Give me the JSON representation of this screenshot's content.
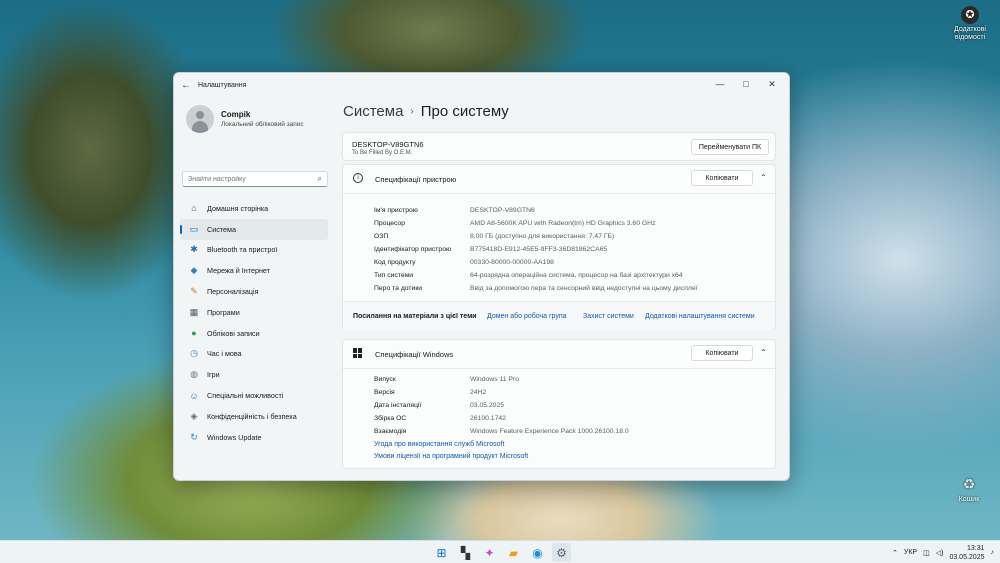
{
  "desktop": {
    "icons": [
      {
        "label": "Додаткові відомості",
        "icon": "info-circle-icon"
      },
      {
        "label": "Кошик",
        "icon": "recycle-bin-icon"
      }
    ]
  },
  "window": {
    "title": "Налаштування",
    "controls": {
      "minimize": "—",
      "maximize": "□",
      "close": "✕"
    }
  },
  "profile": {
    "name": "Compik",
    "subtitle": "Локальний обліковий запис"
  },
  "search": {
    "placeholder": "Знайти настройку"
  },
  "nav": [
    {
      "label": "Домашня сторінка",
      "icon": "home-icon",
      "glyph": "⌂",
      "color": "#555"
    },
    {
      "label": "Система",
      "icon": "monitor-icon",
      "glyph": "▭",
      "color": "#0067c0",
      "active": true
    },
    {
      "label": "Bluetooth та пристрої",
      "icon": "bluetooth-icon",
      "glyph": "✱",
      "color": "#1f6fc0"
    },
    {
      "label": "Мережа й Інтернет",
      "icon": "network-icon",
      "glyph": "◆",
      "color": "#3b7ac7"
    },
    {
      "label": "Персоналізація",
      "icon": "paintbrush-icon",
      "glyph": "✎",
      "color": "#c87a2a"
    },
    {
      "label": "Програми",
      "icon": "apps-icon",
      "glyph": "▦",
      "color": "#4d5a66"
    },
    {
      "label": "Облікові записи",
      "icon": "user-icon",
      "glyph": "●",
      "color": "#2f9b5a"
    },
    {
      "label": "Час і мова",
      "icon": "globe-clock-icon",
      "glyph": "◷",
      "color": "#2c7fd1"
    },
    {
      "label": "Ігри",
      "icon": "gamepad-icon",
      "glyph": "◍",
      "color": "#6b737a"
    },
    {
      "label": "Спеціальні можливості",
      "icon": "accessibility-icon",
      "glyph": "☺",
      "color": "#1f6fc0"
    },
    {
      "label": "Конфіденційність і безпека",
      "icon": "shield-icon",
      "glyph": "◈",
      "color": "#5b6570"
    },
    {
      "label": "Windows Update",
      "icon": "windows-update-icon",
      "glyph": "↻",
      "color": "#1f8ad6"
    }
  ],
  "breadcrumb": {
    "parent": "Система",
    "separator": "›",
    "current": "Про систему"
  },
  "pc": {
    "name": "DESKTOP-V89GTN6",
    "model": "To Be Filled By O.E.M.",
    "rename_label": "Перейменувати ПК"
  },
  "device_specs": {
    "title": "Специфікації пристрою",
    "copy_label": "Копіювати",
    "rows": [
      {
        "k": "Ім'я пристрою",
        "v": "DESKTOP-V89GTN6"
      },
      {
        "k": "Процесор",
        "v": "AMD A8-5600K APU with Radeon(tm) HD Graphics     3.60 GHz"
      },
      {
        "k": "ОЗП",
        "v": "8,00 ГБ (доступно для використання: 7,47 ГБ)"
      },
      {
        "k": "Ідентифікатор пристрою",
        "v": "B775418D-E912-45E5-9FF3-36D81862CA65"
      },
      {
        "k": "Код продукту",
        "v": "00330-80000-00000-AA198"
      },
      {
        "k": "Тип системи",
        "v": "64-розрядна операційна система, процесор на базі архітектури x64"
      },
      {
        "k": "Перо та дотики",
        "v": "Ввід за допомогою пера та сенсорний ввід недоступні на цьому дисплеї"
      }
    ]
  },
  "related": {
    "label": "Посилання на матеріали з цієї теми",
    "links": [
      "Домен або робоча група",
      "Захист системи",
      "Додаткові налаштування системи"
    ]
  },
  "windows_specs": {
    "title": "Специфікації Windows",
    "copy_label": "Копіювати",
    "rows": [
      {
        "k": "Випуск",
        "v": "Windows 11 Pro"
      },
      {
        "k": "Версія",
        "v": "24H2"
      },
      {
        "k": "Дата інсталяції",
        "v": "03.05.2025"
      },
      {
        "k": "Збірка ОС",
        "v": "26100.1742"
      },
      {
        "k": "Взаємодія",
        "v": "Windows Feature Experience Pack 1000.26100.18.0"
      }
    ],
    "links": [
      "Угода про використання служб Microsoft",
      "Умови ліцензії на програмний продукт Microsoft"
    ]
  },
  "taskbar": {
    "apps": [
      {
        "name": "windows-start-icon",
        "glyph": "⊞",
        "color": "#0a6fd1"
      },
      {
        "name": "task-view-icon",
        "glyph": "▚",
        "color": "#333333"
      },
      {
        "name": "copilot-icon",
        "glyph": "✦",
        "color": "#c04fd0"
      },
      {
        "name": "file-explorer-icon",
        "glyph": "▰",
        "color": "#e0a422"
      },
      {
        "name": "edge-icon",
        "glyph": "◉",
        "color": "#1d8fd6"
      },
      {
        "name": "settings-gear-icon",
        "glyph": "⚙",
        "color": "#5b6570",
        "active": true
      }
    ],
    "language": "УКР",
    "time": "13:31",
    "date": "03.05.2025"
  }
}
